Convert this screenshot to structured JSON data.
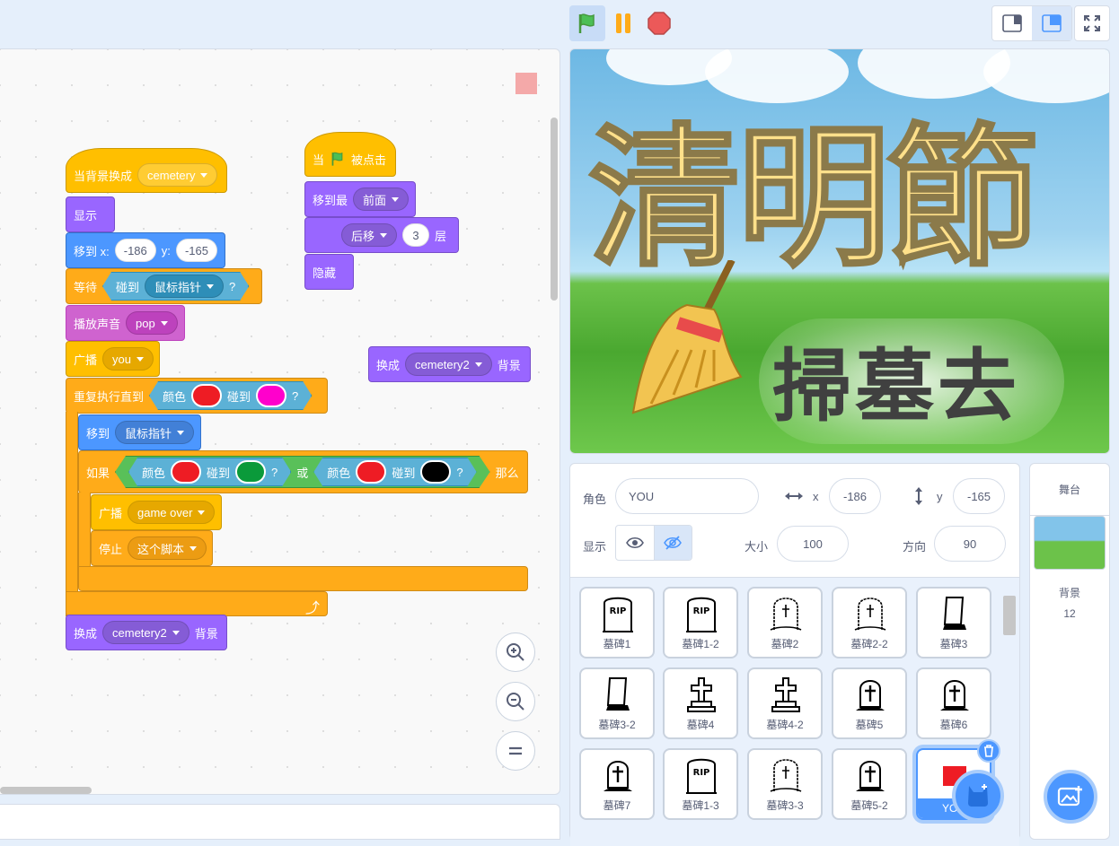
{
  "controls": {
    "flag": "green-flag",
    "pause": "pause",
    "stop": "stop"
  },
  "code": {
    "script1": {
      "hat_label": "当背景换成",
      "hat_value": "cemetery",
      "show": "显示",
      "goto_label": "移到 x:",
      "goto_x": "-186",
      "goto_y_label": "y:",
      "goto_y": "-165",
      "wait_label": "等待",
      "touch_label": "碰到",
      "touch_value": "鼠标指针",
      "q": "?",
      "sound_label": "播放声音",
      "sound_value": "pop",
      "broadcast_label": "广播",
      "broadcast_value": "you",
      "repeat_label": "重复执行直到",
      "color_label": "颜色",
      "touch2_label": "碰到",
      "goto2_label": "移到",
      "goto2_value": "鼠标指针",
      "if_label": "如果",
      "or_label": "或",
      "then_label": "那么",
      "bc2_label": "广播",
      "bc2_value": "game over",
      "stop_label": "停止",
      "stop_value": "这个脚本",
      "switch_label": "换成",
      "switch_value": "cemetery2",
      "switch_suffix": "背景"
    },
    "script2": {
      "hat_prefix": "当",
      "hat_suffix": "被点击",
      "front_label": "移到最",
      "front_value": "前面",
      "layer_value": "后移",
      "layer_num": "3",
      "layer_suffix": "层",
      "hide": "隐藏"
    },
    "loose": {
      "label": "换成",
      "value": "cemetery2",
      "suffix": "背景"
    }
  },
  "colors": {
    "red": "#ee1c24",
    "magenta": "#ff00cc",
    "green": "#0a9a3a",
    "black": "#000000"
  },
  "stage": {
    "title": "清明節",
    "subtitle": "掃墓去"
  },
  "sprite_info": {
    "sprite_label": "角色",
    "sprite_name": "YOU",
    "x_label": "x",
    "x": "-186",
    "y_label": "y",
    "y": "-165",
    "show_label": "显示",
    "size_label": "大小",
    "size": "100",
    "direction_label": "方向",
    "direction": "90"
  },
  "sprites": [
    {
      "name": "墓碑1",
      "icon": "rip"
    },
    {
      "name": "墓碑1-2",
      "icon": "rip"
    },
    {
      "name": "墓碑2",
      "icon": "cross-arch"
    },
    {
      "name": "墓碑2-2",
      "icon": "cross-arch"
    },
    {
      "name": "墓碑3",
      "icon": "slab"
    },
    {
      "name": "墓碑3-2",
      "icon": "slab"
    },
    {
      "name": "墓碑4",
      "icon": "cross"
    },
    {
      "name": "墓碑4-2",
      "icon": "cross"
    },
    {
      "name": "墓碑5",
      "icon": "tomb-cross"
    },
    {
      "name": "墓碑6",
      "icon": "tomb-cross"
    },
    {
      "name": "墓碑7",
      "icon": "tomb-cross"
    },
    {
      "name": "墓碑1-3",
      "icon": "rip"
    },
    {
      "name": "墓碑3-3",
      "icon": "cross-arch"
    },
    {
      "name": "墓碑5-2",
      "icon": "tomb-cross"
    },
    {
      "name": "YOU",
      "icon": "red-square"
    }
  ],
  "stage_panel": {
    "title": "舞台",
    "backdrop_label": "背景",
    "backdrop_count": "12"
  }
}
